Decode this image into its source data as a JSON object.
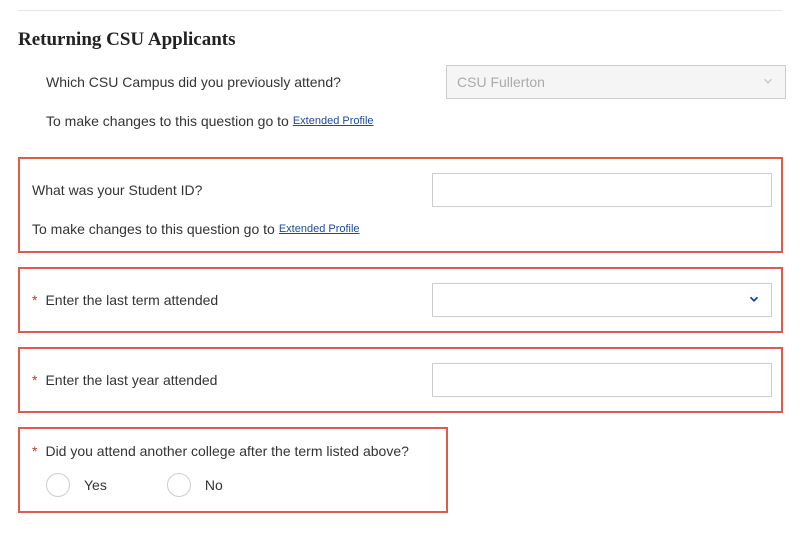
{
  "section": {
    "title": "Returning CSU Applicants"
  },
  "campus": {
    "label": "Which CSU Campus did you previously attend?",
    "value": "CSU Fullerton",
    "goto_text": "To make changes to this question go to",
    "goto_link": "Extended Profile"
  },
  "student_id": {
    "label": "What was your Student ID?",
    "value": "",
    "goto_text": "To make changes to this question go to",
    "goto_link": "Extended Profile"
  },
  "last_term": {
    "label": "Enter the last term attended"
  },
  "last_year": {
    "label": "Enter the last year attended",
    "value": ""
  },
  "other_college": {
    "question": "Did you attend another college after the term listed above?",
    "yes": "Yes",
    "no": "No"
  }
}
